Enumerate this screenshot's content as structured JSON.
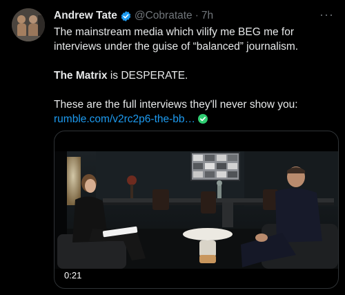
{
  "author": {
    "name": "Andrew Tate",
    "handle": "@Cobratate",
    "separator": "·",
    "time": "7h",
    "more": "···"
  },
  "tweet": {
    "line1": "The mainstream media which vilify me BEG me for interviews under the guise of “balanced” journalism.",
    "matrix_bold": "The Matrix",
    "matrix_rest": " is DESPERATE.",
    "line3": "These are the full interviews they'll never show you:",
    "link": "rumble.com/v2rc2p6-the-bb…"
  },
  "media": {
    "duration": "0:21"
  },
  "colors": {
    "verified": "#1d9bf0",
    "link": "#1d9bf0",
    "secondary_text": "#71767b",
    "emoji_check": "#2ecc71"
  }
}
